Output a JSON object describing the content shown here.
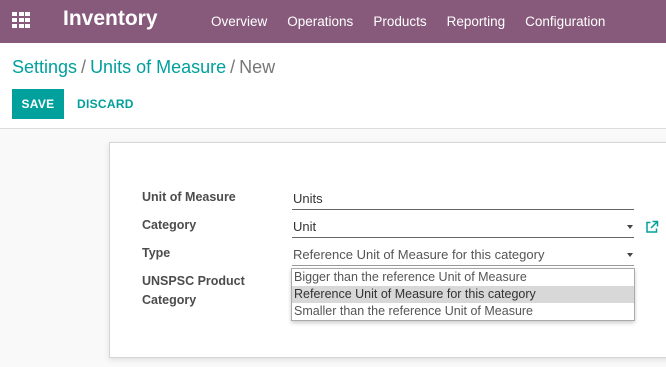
{
  "navbar": {
    "app_title": "Inventory",
    "menu": [
      "Overview",
      "Operations",
      "Products",
      "Reporting",
      "Configuration"
    ],
    "color": "#875a7b"
  },
  "breadcrumb": {
    "settings": "Settings",
    "separator": "/",
    "units": "Units of Measure",
    "current": "New"
  },
  "buttons": {
    "save": "SAVE",
    "discard": "DISCARD",
    "accent": "#00a09d"
  },
  "form": {
    "uom_label": "Unit of Measure",
    "uom_value": "Units",
    "category_label": "Category",
    "category_value": "Unit",
    "type_label": "Type",
    "type_value": "Reference Unit of Measure for this category",
    "unspsc_label_line1": "UNSPSC Product",
    "unspsc_label_line2": "Category"
  },
  "type_dropdown": {
    "options": [
      "Bigger than the reference Unit of Measure",
      "Reference Unit of Measure for this category",
      "Smaller than the reference Unit of Measure"
    ],
    "selected": "Reference Unit of Measure for this category"
  },
  "icons": {
    "apps": "apps-grid-icon",
    "external_link": "external-link-icon",
    "dropdown_caret": "chevron-down-icon"
  }
}
